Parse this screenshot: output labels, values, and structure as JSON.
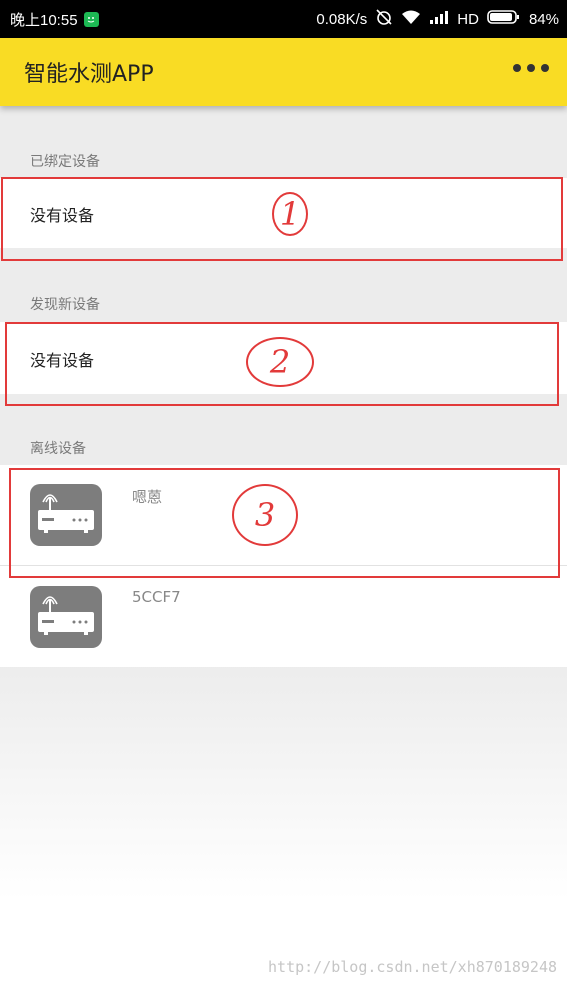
{
  "status_bar": {
    "time": "晚上10:55",
    "speed": "0.08K/s",
    "network": "HD",
    "battery": "84%"
  },
  "app_bar": {
    "title": "智能水测APP"
  },
  "sections": {
    "bound": {
      "label": "已绑定设备",
      "empty_text": "没有设备"
    },
    "discovered": {
      "label": "发现新设备",
      "empty_text": "没有设备"
    },
    "offline": {
      "label": "离线设备",
      "devices": [
        {
          "name": "嗯蒽"
        },
        {
          "name": "5CCF7"
        }
      ]
    }
  },
  "annotations": [
    "1",
    "2",
    "3"
  ],
  "watermark": "http://blog.csdn.net/xh870189248",
  "colors": {
    "app_bar": "#f9dc24",
    "annotation": "#e23a3a",
    "device_icon": "#7d7d7d"
  }
}
